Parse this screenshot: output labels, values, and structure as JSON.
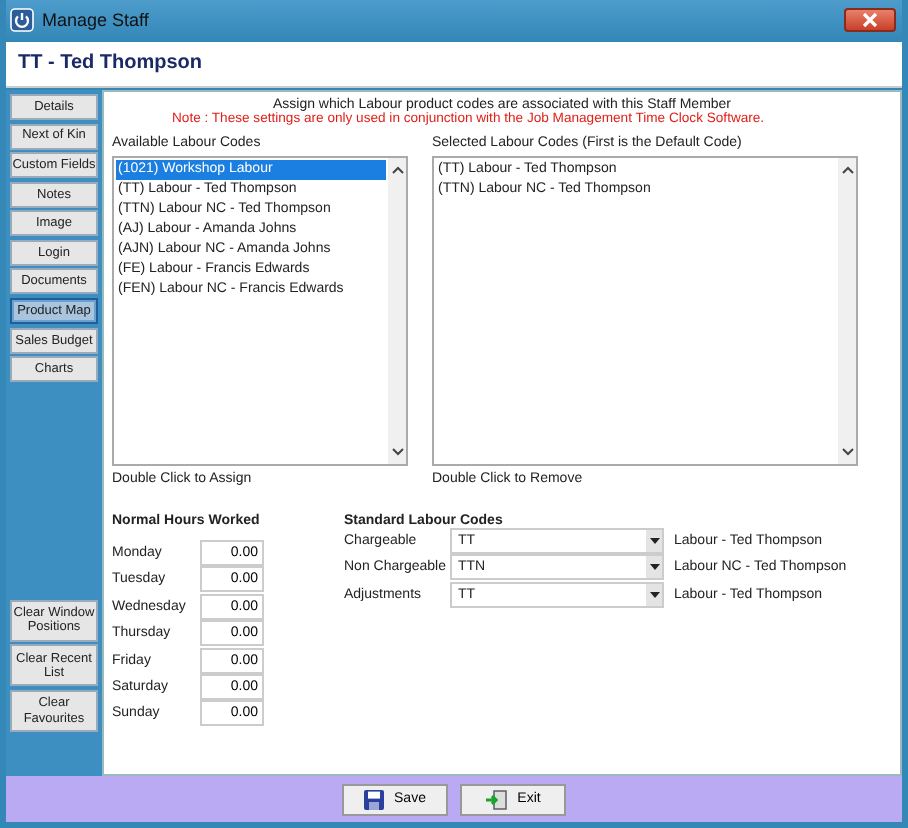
{
  "window": {
    "title": "Manage Staff"
  },
  "header": {
    "title": "TT - Ted Thompson"
  },
  "sidebar": {
    "items": [
      {
        "label": "Details",
        "selected": false
      },
      {
        "label": "Next of Kin",
        "selected": false
      },
      {
        "label": "Custom Fields",
        "selected": false
      },
      {
        "label": "Notes",
        "selected": false
      },
      {
        "label": "Image",
        "selected": false
      },
      {
        "label": "Login",
        "selected": false
      },
      {
        "label": "Documents",
        "selected": false
      },
      {
        "label": "Product Map",
        "selected": true
      },
      {
        "label": "Sales Budget",
        "selected": false
      },
      {
        "label": "Charts",
        "selected": false
      }
    ],
    "bottom_buttons": [
      "Clear Window Positions",
      "Clear Recent List",
      "Clear Favourites"
    ]
  },
  "intro": "Assign which Labour product codes are associated with this Staff Member",
  "note": "Note : These settings are only used in conjunction with the Job Management Time Clock Software.",
  "available": {
    "label": "Available Labour Codes",
    "hint": "Double Click to Assign",
    "items": [
      {
        "label": "(1021) Workshop Labour",
        "selected": true
      },
      {
        "label": "(TT) Labour - Ted Thompson",
        "selected": false
      },
      {
        "label": "(TTN) Labour NC - Ted Thompson",
        "selected": false
      },
      {
        "label": "(AJ) Labour - Amanda Johns",
        "selected": false
      },
      {
        "label": "(AJN) Labour NC - Amanda Johns",
        "selected": false
      },
      {
        "label": "(FE) Labour - Francis Edwards",
        "selected": false
      },
      {
        "label": "(FEN) Labour NC - Francis Edwards",
        "selected": false
      }
    ]
  },
  "selected_codes": {
    "label": "Selected Labour Codes (First is the Default Code)",
    "hint": "Double Click to Remove",
    "items": [
      "(TT) Labour - Ted Thompson",
      "(TTN) Labour NC - Ted Thompson"
    ]
  },
  "hours": {
    "title": "Normal Hours Worked",
    "days": [
      {
        "day": "Monday",
        "value": "0.00"
      },
      {
        "day": "Tuesday",
        "value": "0.00"
      },
      {
        "day": "Wednesday",
        "value": "0.00"
      },
      {
        "day": "Thursday",
        "value": "0.00"
      },
      {
        "day": "Friday",
        "value": "0.00"
      },
      {
        "day": "Saturday",
        "value": "0.00"
      },
      {
        "day": "Sunday",
        "value": "0.00"
      }
    ]
  },
  "standard_codes": {
    "title": "Standard Labour Codes",
    "rows": [
      {
        "label": "Chargeable",
        "code": "TT",
        "description": "Labour - Ted Thompson"
      },
      {
        "label": "Non Chargeable",
        "code": "TTN",
        "description": "Labour NC - Ted Thompson"
      },
      {
        "label": "Adjustments",
        "code": "TT",
        "description": "Labour - Ted Thompson"
      }
    ]
  },
  "buttons": [
    {
      "label": "Save",
      "kind": "save"
    },
    {
      "label": "Exit",
      "kind": "exit"
    }
  ]
}
